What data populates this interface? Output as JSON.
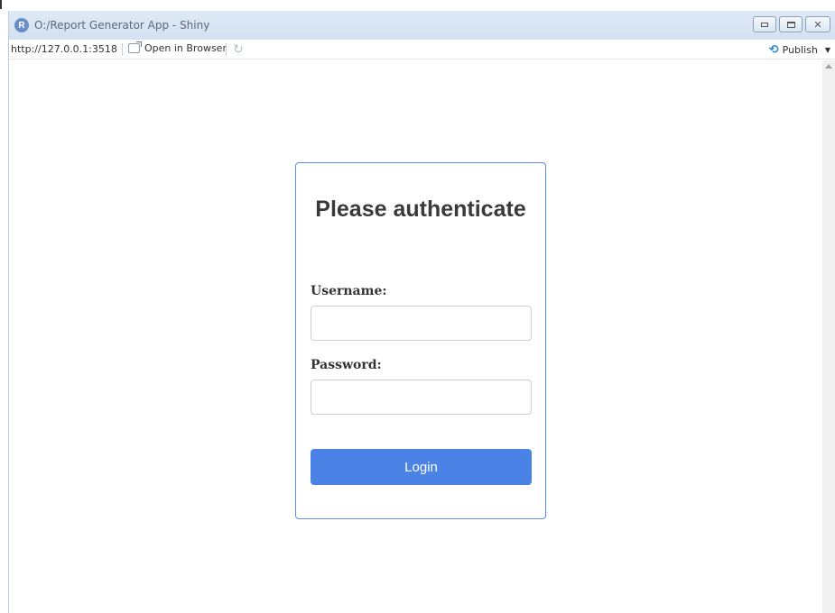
{
  "window": {
    "title": "O:/Report Generator App - Shiny",
    "app_icon_letter": "R"
  },
  "toolbar": {
    "url": "http://127.0.0.1:3518",
    "open_in_browser": "Open in Browser",
    "publish": "Publish"
  },
  "login": {
    "title": "Please authenticate",
    "username_label": "Username:",
    "username_value": "",
    "password_label": "Password:",
    "password_value": "",
    "login_button": "Login"
  },
  "colors": {
    "accent": "#4a82e6",
    "panel_border": "#5b8def"
  }
}
